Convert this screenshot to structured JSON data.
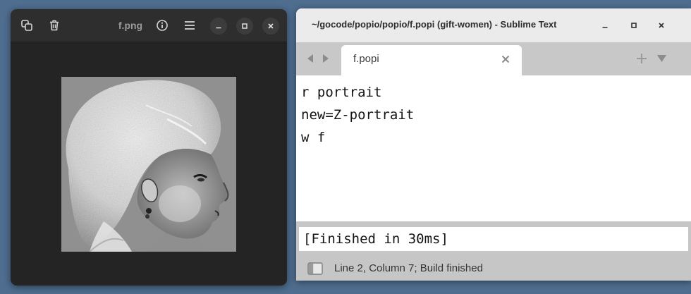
{
  "viewer": {
    "title": "f.png",
    "image_alt": "inverted grayscale portrait of a woman in profile"
  },
  "sublime": {
    "window_title": "~/gocode/popio/popio/f.popi (gift-women) - Sublime Text",
    "tab_label": "f.popi",
    "code_lines": [
      "r portrait",
      "new=Z-portrait",
      "w f"
    ],
    "output": "[Finished in 30ms]",
    "status": "Line 2, Column 7; Build finished"
  },
  "colors": {
    "viewer_bg": "#242424",
    "sublime_tabbar": "#c8c8c8",
    "sublime_statusbar": "#c6c6c6"
  }
}
